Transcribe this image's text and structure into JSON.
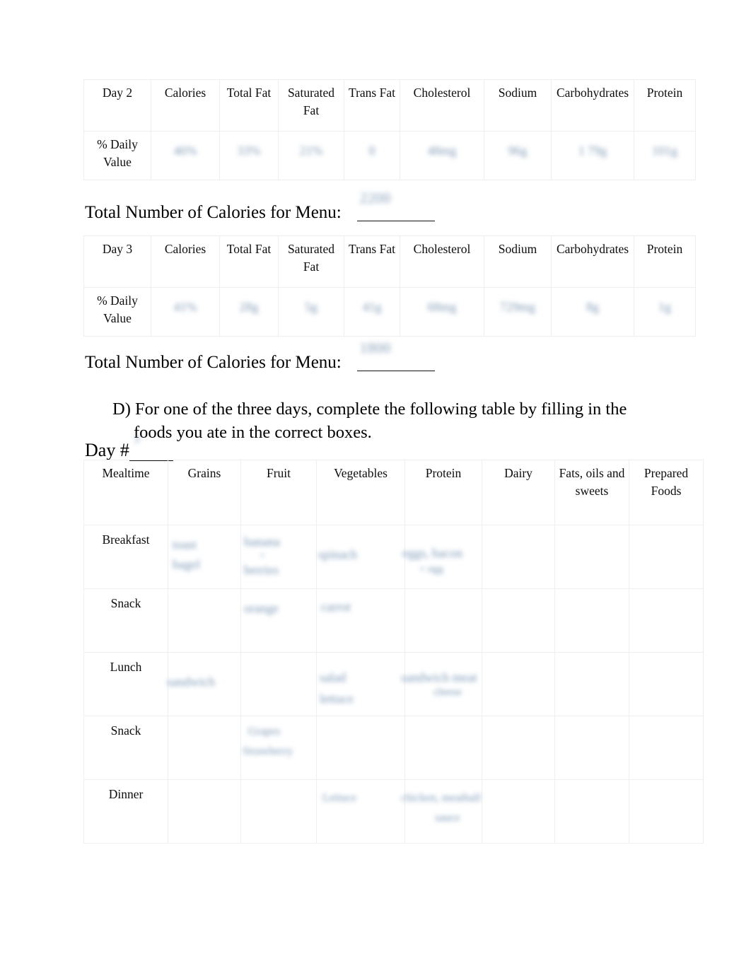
{
  "document": {
    "type": "worksheet-page",
    "page_background": "#ffffff",
    "text_color": "#000000",
    "table_border_color": "#edf0f2",
    "handwriting_color": "#5d7fa0"
  },
  "nutrition_tables": [
    {
      "id": "day-2",
      "columns": [
        "Day 2",
        "Calories",
        "Total Fat",
        "Saturated Fat",
        "Trans Fat",
        "Cholesterol",
        "Sodium",
        "Carbohydrates",
        "Protein"
      ],
      "row_label": "% Daily Value",
      "values": [
        "",
        "",
        "",
        "",
        "",
        "",
        "",
        ""
      ],
      "values_legible": false,
      "total_label": "Total Number of Calories for Menu:",
      "total_value": "",
      "total_value_legible": false
    },
    {
      "id": "day-3",
      "columns": [
        "Day 3",
        "Calories",
        "Total Fat",
        "Saturated Fat",
        "Trans Fat",
        "Cholesterol",
        "Sodium",
        "Carbohydrates",
        "Protein"
      ],
      "row_label": "% Daily Value",
      "values": [
        "",
        "",
        "",
        "",
        "",
        "",
        "",
        ""
      ],
      "values_legible": false,
      "total_label": "Total Number of Calories for Menu:",
      "total_value": "",
      "total_value_legible": false
    }
  ],
  "instruction": {
    "marker": "D)",
    "line1": "For one of the three days, complete the following table by filling in the",
    "line2": "foods you ate in the correct boxes."
  },
  "day_field": {
    "label": "Day #",
    "value": ""
  },
  "food_table": {
    "columns": [
      "Mealtime",
      "Grains",
      "Fruit",
      "Vegetables",
      "Protein",
      "Dairy",
      "Fats, oils and sweets",
      "Prepared Foods"
    ],
    "rows": [
      {
        "mealtime": "Breakfast",
        "cells": [
          "",
          "",
          "",
          "",
          "",
          "",
          ""
        ]
      },
      {
        "mealtime": "Snack",
        "cells": [
          "",
          "",
          "",
          "",
          "",
          "",
          ""
        ]
      },
      {
        "mealtime": "Lunch",
        "cells": [
          "",
          "",
          "",
          "",
          "",
          "",
          ""
        ]
      },
      {
        "mealtime": "Snack",
        "cells": [
          "",
          "",
          "",
          "",
          "",
          "",
          ""
        ]
      },
      {
        "mealtime": "Dinner",
        "cells": [
          "",
          "",
          "",
          "",
          "",
          "",
          ""
        ]
      }
    ],
    "cells_legible": false
  }
}
